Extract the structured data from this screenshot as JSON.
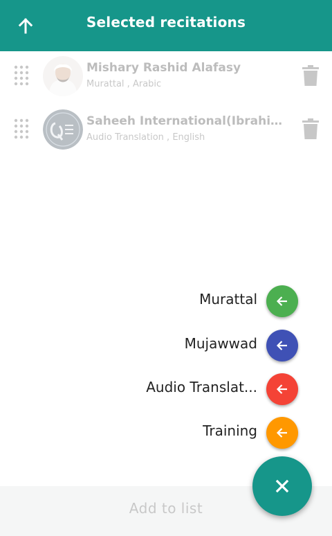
{
  "header": {
    "title": "Selected recitations",
    "back_icon": "arrow-up-icon",
    "color": "#16968a"
  },
  "recitations": [
    {
      "name": "Mishary Rashid Alafasy",
      "type": "Murattal",
      "language": "Arabic"
    },
    {
      "name": "Saheeh International(Ibrahim Walk)",
      "type": "Audio Translation",
      "language": "English"
    }
  ],
  "fab_menu": [
    {
      "label": "Murattal",
      "color": "#4caf50",
      "icon": "arrow-left-icon"
    },
    {
      "label": "Mujawwad",
      "color": "#3f51b5",
      "icon": "arrow-left-icon"
    },
    {
      "label": "Audio Translat...",
      "color": "#f44336",
      "icon": "arrow-left-icon"
    },
    {
      "label": "Training",
      "color": "#ff9800",
      "icon": "arrow-left-icon"
    }
  ],
  "bottom": {
    "add_label": "Add to list"
  },
  "fab_main": {
    "icon": "close-icon",
    "color": "#16968a"
  }
}
